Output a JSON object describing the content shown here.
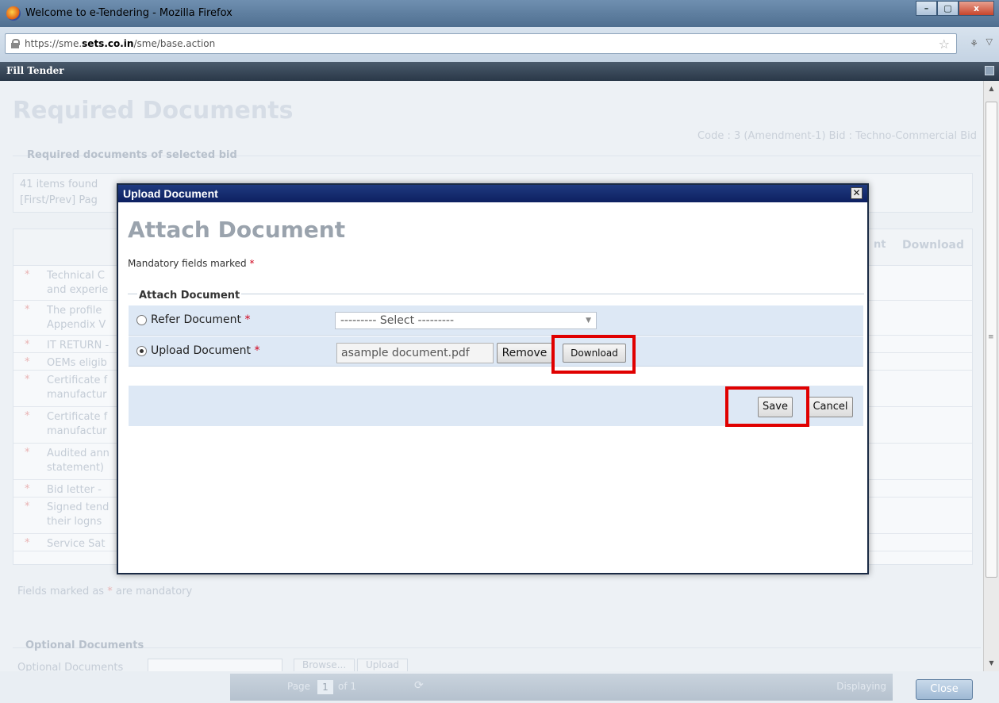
{
  "browser": {
    "window_title": "Welcome to e-Tendering - Mozilla Firefox",
    "url_prefix": "https://sme.",
    "url_domain": "sets.co.in",
    "url_path": "/sme/base.action",
    "window_buttons": [
      "–",
      "▢",
      "x"
    ]
  },
  "app": {
    "window_title": "Fill Tender"
  },
  "background": {
    "page_title": "Required Documents",
    "code_info": "Code : 3 (Amendment-1) Bid : Techno-Commercial Bid",
    "section_title": "Required documents of selected bid",
    "items_found": "41 items found",
    "pager_text": "[First/Prev] Pag",
    "table_headers": {
      "document": "nt",
      "download": "Download"
    },
    "rows": [
      {
        "marker": "*",
        "text": "Technical C\nand experie"
      },
      {
        "marker": "*",
        "text": "The profile\nAppendix V"
      },
      {
        "marker": "*",
        "text": "IT RETURN -"
      },
      {
        "marker": "*",
        "text": "OEMs eligib"
      },
      {
        "marker": "*",
        "text": "Certificate f\nmanufactur"
      },
      {
        "marker": "*",
        "text": "Certificate f\nmanufactur"
      },
      {
        "marker": "*",
        "text": "Audited ann\nstatement)"
      },
      {
        "marker": "*",
        "text": "Bid letter -"
      },
      {
        "marker": "*",
        "text": "Signed tend\ntheir logns"
      },
      {
        "marker": "*",
        "text": "Service Sat"
      }
    ],
    "fields_note_prefix": "Fields marked as",
    "fields_note_suffix": "are mandatory",
    "optional_title": "Optional Documents",
    "optional_label": "Optional Documents",
    "browse_label": "Browse...",
    "upload_label": "Upload"
  },
  "pager_bar": {
    "page_label": "Page",
    "page_value": "1",
    "of_label": "of 1",
    "displaying": "Displaying",
    "close_label": "Close"
  },
  "dialog": {
    "title": "Upload Document",
    "close_glyph": "✕",
    "heading": "Attach Document",
    "mandatory_note": "Mandatory fields marked",
    "required_marker": "*",
    "fieldset_legend": "Attach Document",
    "refer_label": "Refer Document",
    "refer_select_value": "--------- Select ---------",
    "upload_label": "Upload Document",
    "file_name": "asample document.pdf",
    "remove_label": "Remove",
    "download_label": "Download",
    "save_label": "Save",
    "cancel_label": "Cancel",
    "selected_option": "upload"
  },
  "highlight_color": "#e00000"
}
